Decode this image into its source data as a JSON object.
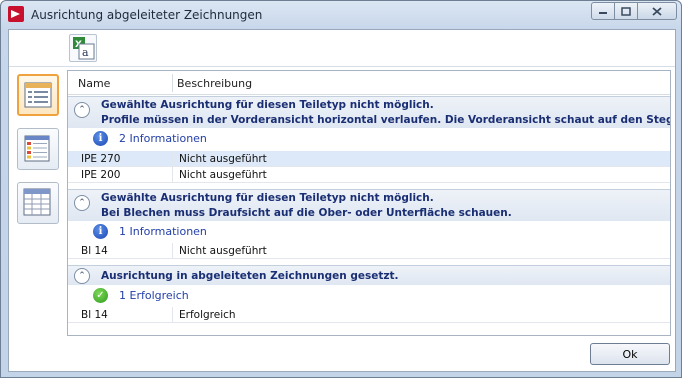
{
  "window": {
    "title": "Ausrichtung abgeleiteter Zeichnungen",
    "app_icon": "hicad-logo-icon",
    "buttons": {
      "minimize": "minimize-icon",
      "maximize": "maximize-icon",
      "close": "close-icon"
    }
  },
  "toolbar": {
    "export_icon": "excel-export-icon"
  },
  "sidebar": {
    "items": [
      {
        "icon": "list-view-icon",
        "active": true
      },
      {
        "icon": "colored-table-icon",
        "active": false
      },
      {
        "icon": "table-grid-icon",
        "active": false
      }
    ]
  },
  "list": {
    "columns": {
      "name": "Name",
      "description": "Beschreibung"
    },
    "groups": [
      {
        "title_line1": "Gewählte Ausrichtung für diesen Teiletyp nicht möglich.",
        "title_line2": "Profile müssen in der Vorderansicht horizontal verlaufen. Die Vorderansicht schaut auf den Steg.",
        "status_icon": "info-icon",
        "status_text": "2 Informationen",
        "rows": [
          {
            "name": "IPE 270",
            "description": "Nicht ausgeführt",
            "selected": true
          },
          {
            "name": "IPE 200",
            "description": "Nicht ausgeführt",
            "selected": false
          }
        ]
      },
      {
        "title_line1": "Gewählte Ausrichtung für diesen Teiletyp nicht möglich.",
        "title_line2": "Bei Blechen muss Draufsicht auf die Ober- oder Unterfläche schauen.",
        "status_icon": "info-icon",
        "status_text": "1 Informationen",
        "rows": [
          {
            "name": "Bl 14",
            "description": "Nicht ausgeführt",
            "selected": false
          }
        ]
      },
      {
        "title_line1": "Ausrichtung in abgeleiteten Zeichnungen gesetzt.",
        "status_icon": "success-check-icon",
        "status_text": "1 Erfolgreich",
        "rows": [
          {
            "name": "Bl 14",
            "description": "Erfolgreich",
            "selected": false
          }
        ]
      }
    ]
  },
  "footer": {
    "ok_label": "Ok"
  }
}
